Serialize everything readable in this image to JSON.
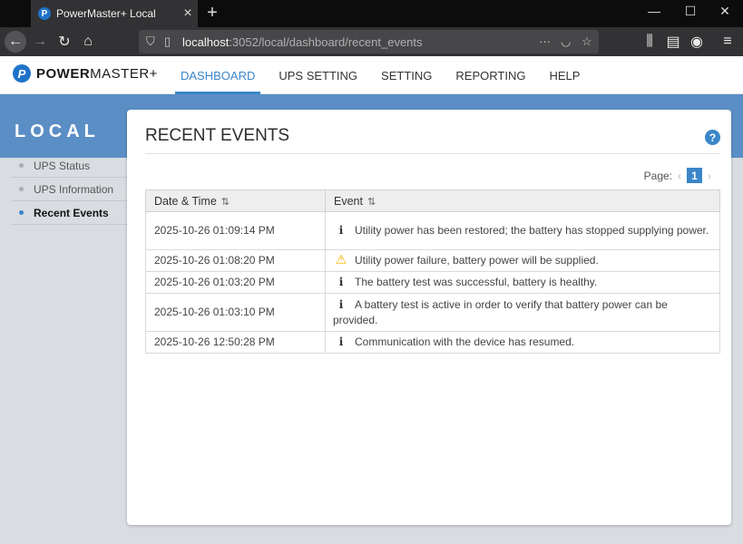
{
  "browser": {
    "tab_title": "PowerMaster+ Local",
    "url_host": "localhost",
    "url_rest": ":3052/local/dashboard/recent_events"
  },
  "app": {
    "logo_bold": "POWER",
    "logo_rest": "MASTER+",
    "nav": [
      {
        "label": "DASHBOARD",
        "active": true
      },
      {
        "label": "UPS SETTING",
        "active": false
      },
      {
        "label": "SETTING",
        "active": false
      },
      {
        "label": "REPORTING",
        "active": false
      },
      {
        "label": "HELP",
        "active": false
      }
    ]
  },
  "sidebar": {
    "title": "LOCAL",
    "items": [
      {
        "label": "UPS Status",
        "active": false
      },
      {
        "label": "UPS Information",
        "active": false
      },
      {
        "label": "Recent Events",
        "active": true
      }
    ]
  },
  "content": {
    "title": "RECENT EVENTS",
    "pager_label": "Page:",
    "page": "1",
    "columns": [
      "Date & Time",
      "Event"
    ],
    "rows": [
      {
        "datetime": "2025-10-26 01:09:14 PM",
        "icon": "info-icon",
        "event": "Utility power has been restored; the battery has stopped supplying power."
      },
      {
        "datetime": "2025-10-26 01:08:20 PM",
        "icon": "warning-icon",
        "event": "Utility power failure, battery power will be supplied."
      },
      {
        "datetime": "2025-10-26 01:03:20 PM",
        "icon": "info-icon",
        "event": "The battery test was successful, battery is healthy."
      },
      {
        "datetime": "2025-10-26 01:03:10 PM",
        "icon": "info-icon",
        "event": "A battery test is active in order to verify that battery power can be provided."
      },
      {
        "datetime": "2025-10-26 12:50:28 PM",
        "icon": "info-icon",
        "event": "Communication with the device has resumed."
      }
    ]
  },
  "colors": {
    "accent": "#3a86c8",
    "band": "#5b8ec5",
    "warning": "#f0b400"
  }
}
